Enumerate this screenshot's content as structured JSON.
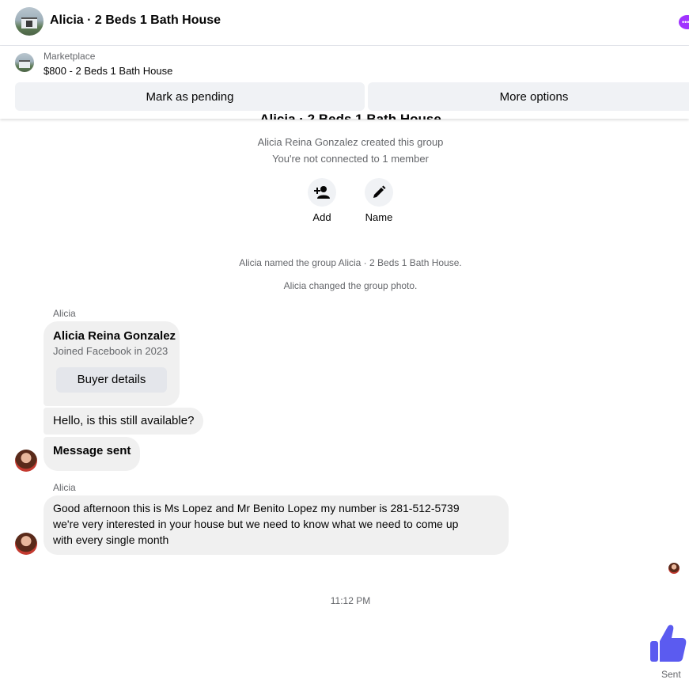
{
  "header": {
    "title": "Alicia · 2 Beds 1 Bath House",
    "more_icon": "ellipsis-icon",
    "accent": "#a033ff"
  },
  "listing": {
    "source": "Marketplace",
    "price_title": "$800 - 2 Beds 1 Bath House",
    "mark_pending": "Mark as pending",
    "more_options": "More options"
  },
  "group": {
    "title": "Alicia · 2 Beds 1 Bath House",
    "created_by": "Alicia Reina Gonzalez created this group",
    "connection": "You're not connected to 1 member",
    "actions": [
      {
        "label": "Add",
        "icon": "add-person-icon"
      },
      {
        "label": "Name",
        "icon": "pencil-icon"
      }
    ]
  },
  "system_messages": [
    "Alicia named the group Alicia · 2 Beds 1 Bath House.",
    "Alicia changed the group photo."
  ],
  "thread": {
    "sender_1": "Alicia",
    "profile_card": {
      "name": "Alicia Reina Gonzalez",
      "joined": "Joined Facebook in 2023",
      "button": "Buyer details"
    },
    "message_1": "Hello, is this still available?",
    "message_2": "Message sent",
    "sender_2": "Alicia",
    "message_3_lines": [
      "Good afternoon this is Ms Lopez and Mr Benito Lopez my number is 281-512-5739",
      "we're very interested in your house but we need to know what we need to come up",
      "with every single month"
    ],
    "timestamp": "11:12 PM",
    "like_icon": "thumbs-up-icon",
    "like_color": "#5b5bf0",
    "status": "Sent"
  }
}
